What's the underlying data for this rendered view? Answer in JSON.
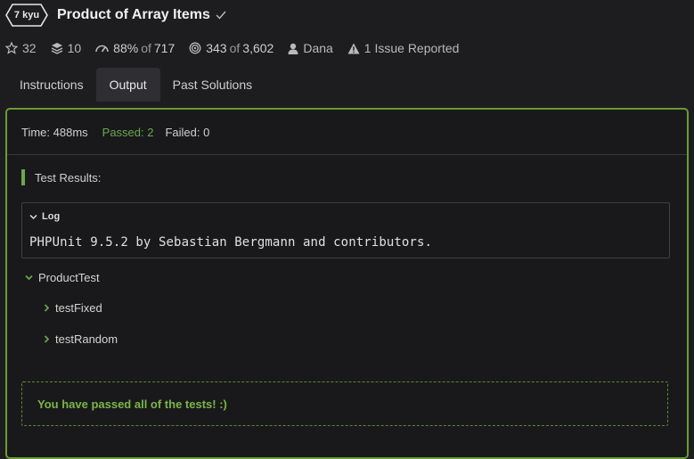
{
  "header": {
    "kyu": "7 kyu",
    "title": "Product of Array Items"
  },
  "stats": {
    "stars": "32",
    "collections": "10",
    "satisfaction_pct": "88%",
    "satisfaction_of": "of",
    "satisfaction_total": "717",
    "completed": "343",
    "completed_of": "of",
    "completed_total": "3,602",
    "author": "Dana",
    "issues": "1 Issue Reported"
  },
  "tabs": [
    "Instructions",
    "Output",
    "Past Solutions"
  ],
  "summary": {
    "time": "Time: 488ms",
    "passed": "Passed: 2",
    "failed": "Failed: 0"
  },
  "results": {
    "heading": "Test Results:",
    "log_label": "Log",
    "log_text": "PHPUnit 9.5.2 by Sebastian Bergmann and contributors.",
    "suite": "ProductTest",
    "tests": [
      "testFixed",
      "testRandom"
    ],
    "success_message": "You have passed all of the tests! :)"
  },
  "colors": {
    "accent": "#6aa84f",
    "panel_border": "#6b9a35",
    "background": "#1d1d1f"
  }
}
